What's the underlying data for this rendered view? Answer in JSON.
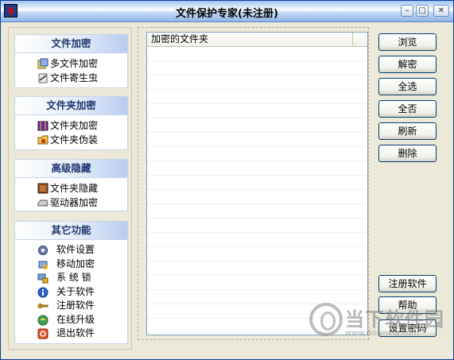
{
  "window": {
    "title": "文件保护专家(未注册)"
  },
  "sidebar": {
    "groups": [
      {
        "title": "文件加密",
        "items": [
          {
            "label": "多文件加密",
            "icon": "multi-file-encrypt-icon"
          },
          {
            "label": "文件寄生虫",
            "icon": "file-parasite-icon"
          }
        ]
      },
      {
        "title": "文件夹加密",
        "items": [
          {
            "label": "文件夹加密",
            "icon": "folder-encrypt-icon"
          },
          {
            "label": "文件夹伪装",
            "icon": "folder-disguise-icon"
          }
        ]
      },
      {
        "title": "高级隐藏",
        "items": [
          {
            "label": "文件夹隐藏",
            "icon": "folder-hide-icon"
          },
          {
            "label": "驱动器加密",
            "icon": "drive-encrypt-icon"
          }
        ]
      },
      {
        "title": "其它功能",
        "items": [
          {
            "label": "软件设置",
            "icon": "settings-gear-icon"
          },
          {
            "label": "移动加密",
            "icon": "mobile-encrypt-icon"
          },
          {
            "label": "系 统 锁",
            "icon": "system-lock-icon"
          },
          {
            "label": "关于软件",
            "icon": "info-icon"
          },
          {
            "label": "注册软件",
            "icon": "register-key-icon"
          },
          {
            "label": "在线升级",
            "icon": "online-upgrade-icon"
          },
          {
            "label": "退出软件",
            "icon": "exit-icon"
          }
        ]
      }
    ]
  },
  "list": {
    "column_header": "加密的文件夹"
  },
  "buttons": {
    "browse": "浏览",
    "decrypt": "解密",
    "select_all": "全选",
    "select_none": "全否",
    "refresh": "刷新",
    "delete": "删除",
    "register": "注册软件",
    "help": "帮助",
    "set_password": "设置密码"
  },
  "watermark": {
    "brand": "当下软件园",
    "url": "www.downxia.com"
  },
  "colors": {
    "title_gradient_top": "#9cc2f3",
    "group_header_text": "#1c3570",
    "button_border": "#003c74"
  }
}
